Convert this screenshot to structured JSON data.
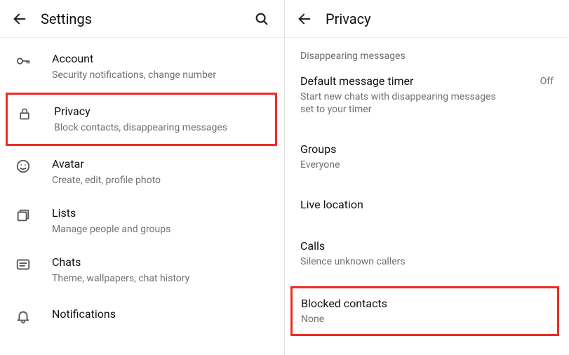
{
  "left": {
    "title": "Settings",
    "items": [
      {
        "title": "Account",
        "sub": "Security notifications, change number"
      },
      {
        "title": "Privacy",
        "sub": "Block contacts, disappearing messages",
        "highlight": true
      },
      {
        "title": "Avatar",
        "sub": "Create, edit, profile photo"
      },
      {
        "title": "Lists",
        "sub": "Manage people and groups"
      },
      {
        "title": "Chats",
        "sub": "Theme, wallpapers, chat history"
      },
      {
        "title": "Notifications",
        "sub": ""
      }
    ]
  },
  "right": {
    "title": "Privacy",
    "section_header": "Disappearing messages",
    "items": [
      {
        "title": "Default message timer",
        "sub": "Start new chats with disappearing messages set to your timer",
        "value": "Off"
      },
      {
        "title": "Groups",
        "sub": "Everyone"
      },
      {
        "title": "Live location",
        "sub": ""
      },
      {
        "title": "Calls",
        "sub": "Silence unknown callers"
      },
      {
        "title": "Blocked contacts",
        "sub": "None",
        "highlight": true
      }
    ]
  }
}
